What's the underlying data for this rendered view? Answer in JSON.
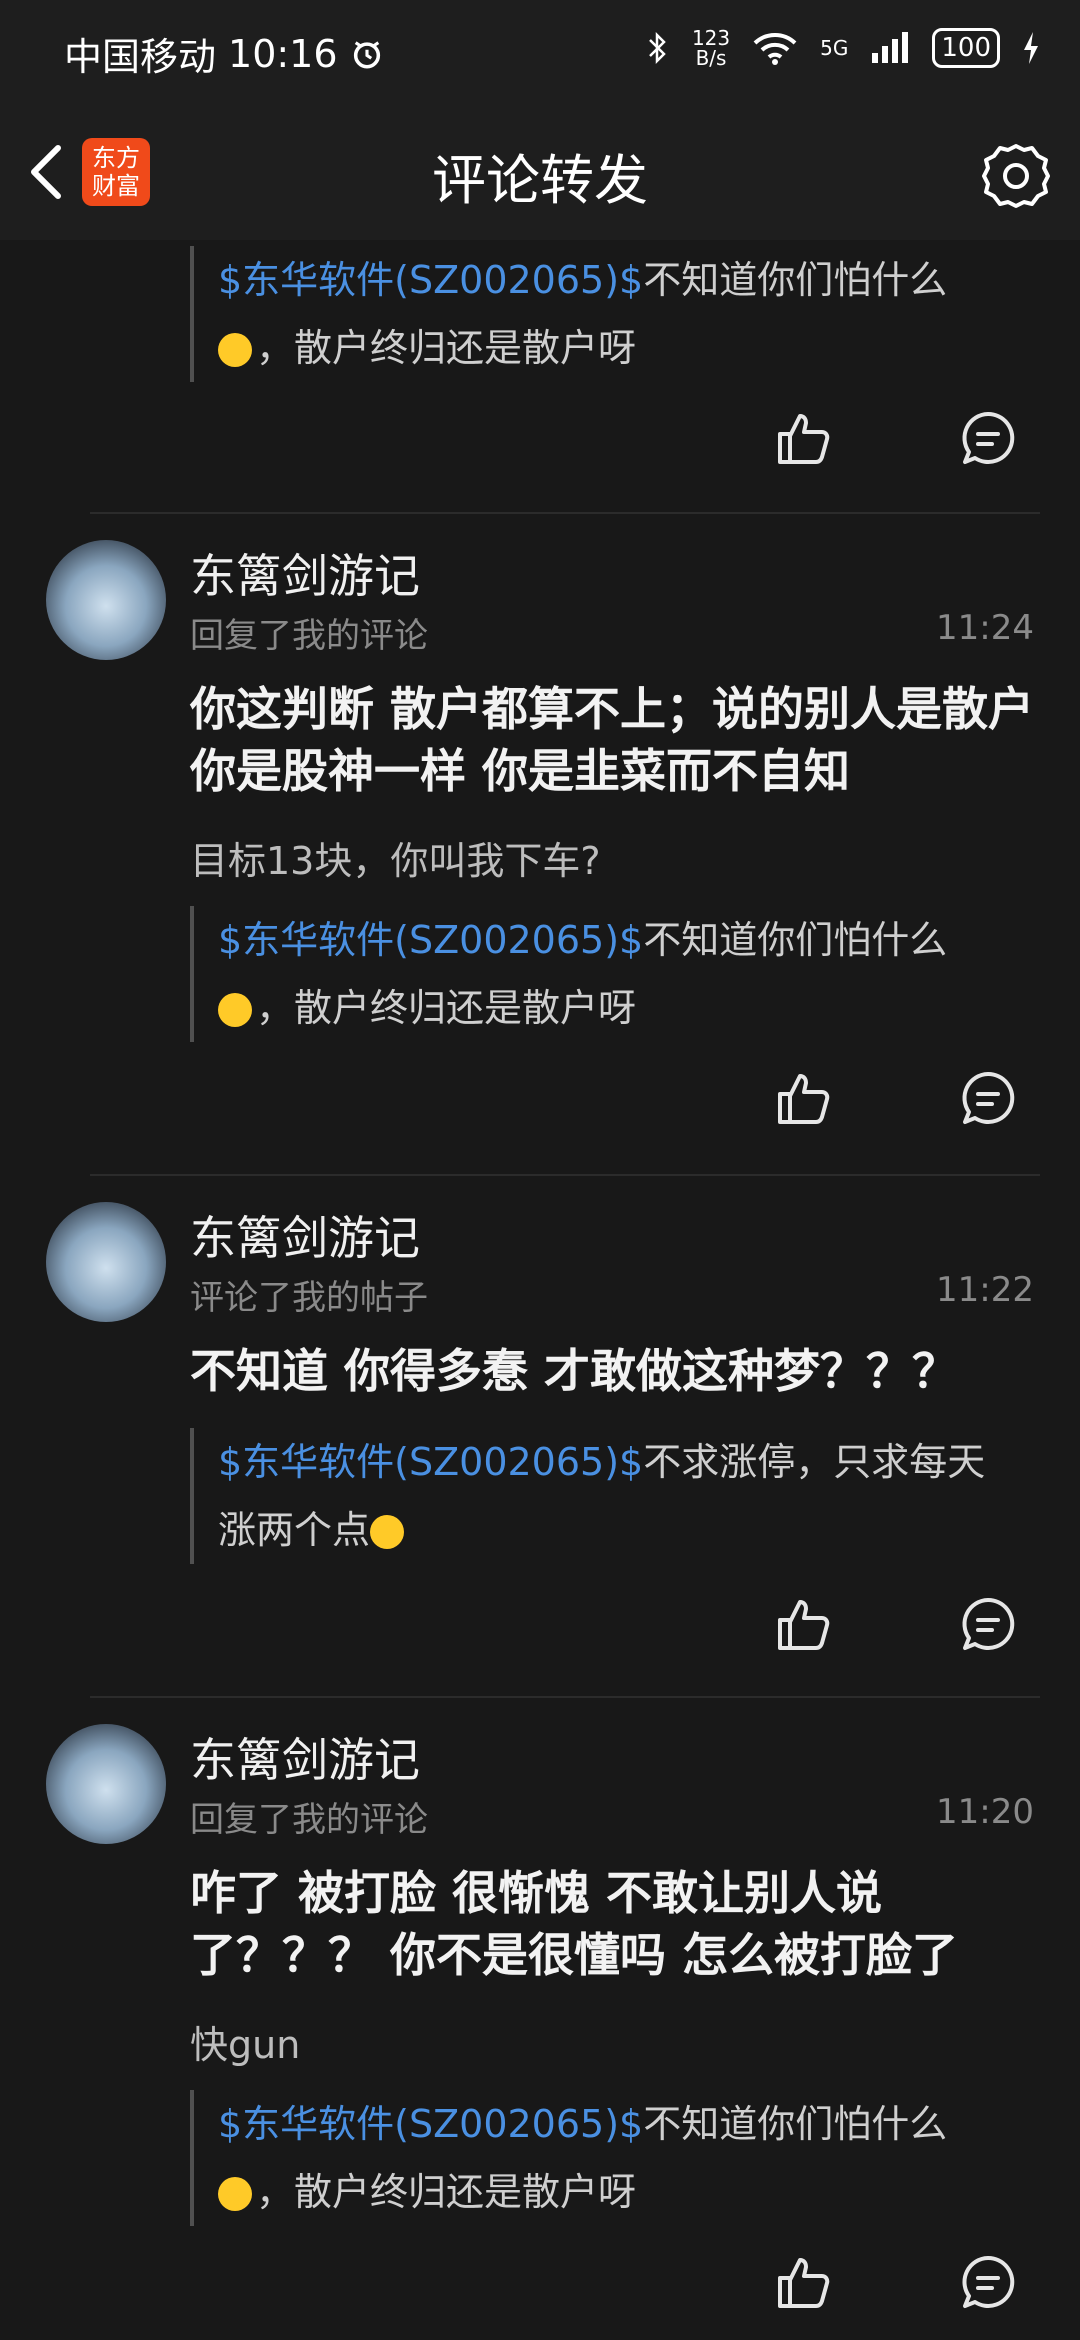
{
  "status_bar": {
    "carrier": "中国移动",
    "time": "10:16",
    "net_speed_value": "123",
    "net_speed_unit": "B/s",
    "network": "5G",
    "battery": "100"
  },
  "header": {
    "logo_line1": "东方",
    "logo_line2": "财富",
    "title": "评论转发"
  },
  "top_quote": {
    "link": "$东华软件(SZ002065)$",
    "text1": "不知道你们怕什么",
    "text2": "，散户终归还是散户呀"
  },
  "comments": [
    {
      "username": "东篱剑游记",
      "subtitle": "回复了我的评论",
      "time": "11:24",
      "body": "你这判断 散户都算不上；说的别人是散户 你是股神一样   你是韭菜而不自知",
      "reply": "目标13块，你叫我下车?",
      "quote_link": "$东华软件(SZ002065)$",
      "quote_text1": "不知道你们怕什么",
      "quote_text2": "，散户终归还是散户呀"
    },
    {
      "username": "东篱剑游记",
      "subtitle": "评论了我的帖子",
      "time": "11:22",
      "body": "不知道 你得多惷 才敢做这种梦？？？",
      "quote_link": "$东华软件(SZ002065)$",
      "quote_text1": "不求涨停，只求每天",
      "quote_text2": "涨两个点"
    },
    {
      "username": "东篱剑游记",
      "subtitle": "回复了我的评论",
      "time": "11:20",
      "body": "咋了    被打脸 很惭愧   不敢让别人说了？？？ 你不是很懂吗  怎么被打脸了",
      "reply": "快gun",
      "quote_link": "$东华软件(SZ002065)$",
      "quote_text1": "不知道你们怕什么",
      "quote_text2": "，散户终归还是散户呀"
    }
  ]
}
